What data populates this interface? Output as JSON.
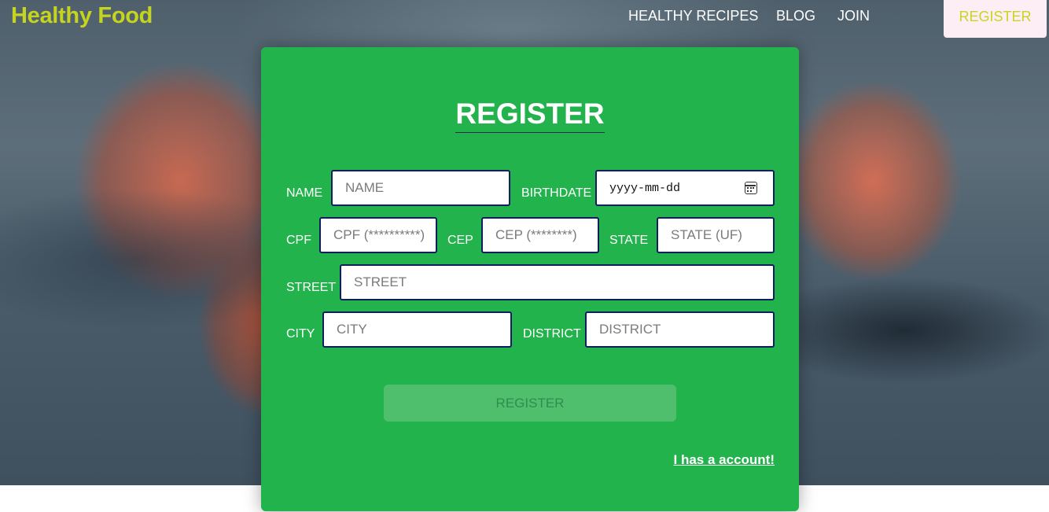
{
  "nav": {
    "brand": "Healthy Food",
    "links": [
      "HEALTHY RECIPES",
      "BLOG",
      "JOIN"
    ],
    "register": "REGISTER"
  },
  "form": {
    "title": "REGISTER",
    "fields": {
      "name": {
        "label": "NAME",
        "placeholder": "NAME"
      },
      "birthdate": {
        "label": "BIRTHDATE",
        "value": "yyyy-mm-dd"
      },
      "cpf": {
        "label": "CPF",
        "placeholder": "CPF (**********)"
      },
      "cep": {
        "label": "CEP",
        "placeholder": "CEP (********)"
      },
      "state": {
        "label": "STATE",
        "placeholder": "STATE (UF)"
      },
      "street": {
        "label": "STREET",
        "placeholder": "STREET"
      },
      "city": {
        "label": "CITY",
        "placeholder": "CITY"
      },
      "district": {
        "label": "DISTRICT",
        "placeholder": "DISTRICT"
      }
    },
    "submit": "REGISTER",
    "account_link": "I has a account!"
  },
  "colors": {
    "brand": "#c5d41f",
    "card": "#22b34d",
    "input_border": "#0c1f5c",
    "register_bg": "#fdeef6"
  },
  "icons": {
    "calendar": "calendar-icon"
  }
}
